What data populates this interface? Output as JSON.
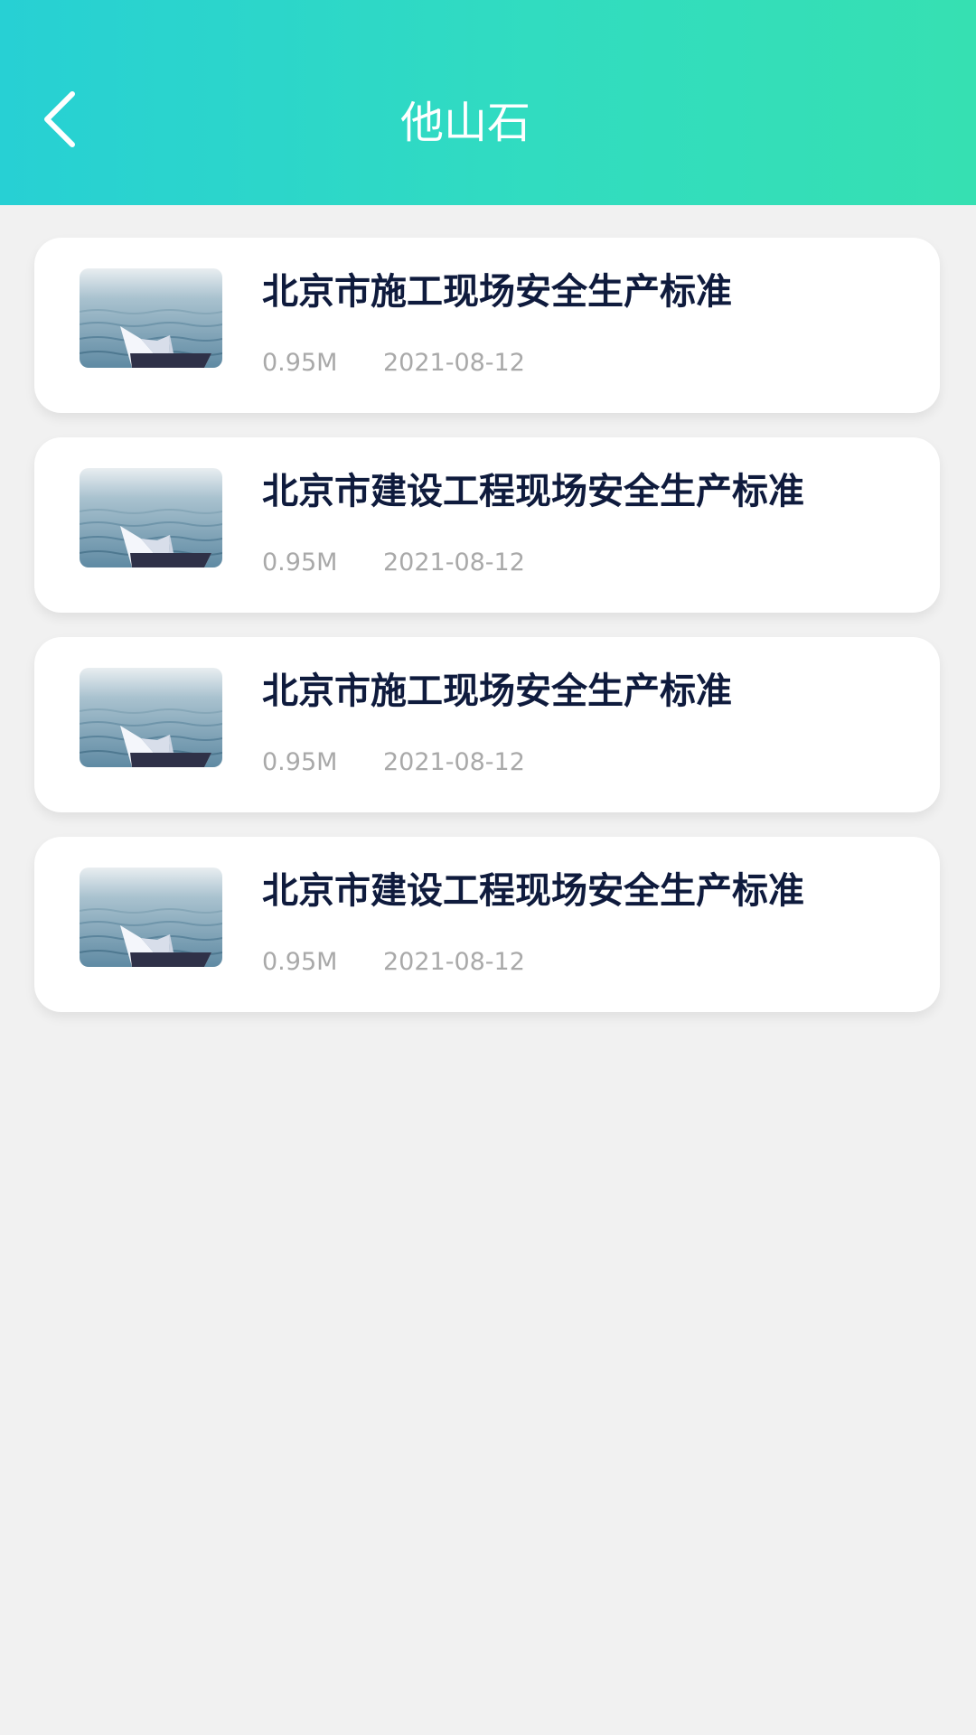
{
  "header": {
    "title": "他山石",
    "back_icon": "chevron-left-icon",
    "gradient": [
      "#27d0d4",
      "#36e0b2"
    ]
  },
  "documents": [
    {
      "title": "北京市施工现场安全生产标准",
      "size": "0.95M",
      "date": "2021-08-12",
      "thumbnail": "paper-boat-on-water"
    },
    {
      "title": "北京市建设工程现场安全生产标准",
      "size": "0.95M",
      "date": "2021-08-12",
      "thumbnail": "paper-boat-on-water"
    },
    {
      "title": "北京市施工现场安全生产标准",
      "size": "0.95M",
      "date": "2021-08-12",
      "thumbnail": "paper-boat-on-water"
    },
    {
      "title": "北京市建设工程现场安全生产标准",
      "size": "0.95M",
      "date": "2021-08-12",
      "thumbnail": "paper-boat-on-water"
    }
  ],
  "colors": {
    "background": "#f1f1f1",
    "title_text": "#0f1b3d",
    "meta_text": "#a9a9a9"
  }
}
